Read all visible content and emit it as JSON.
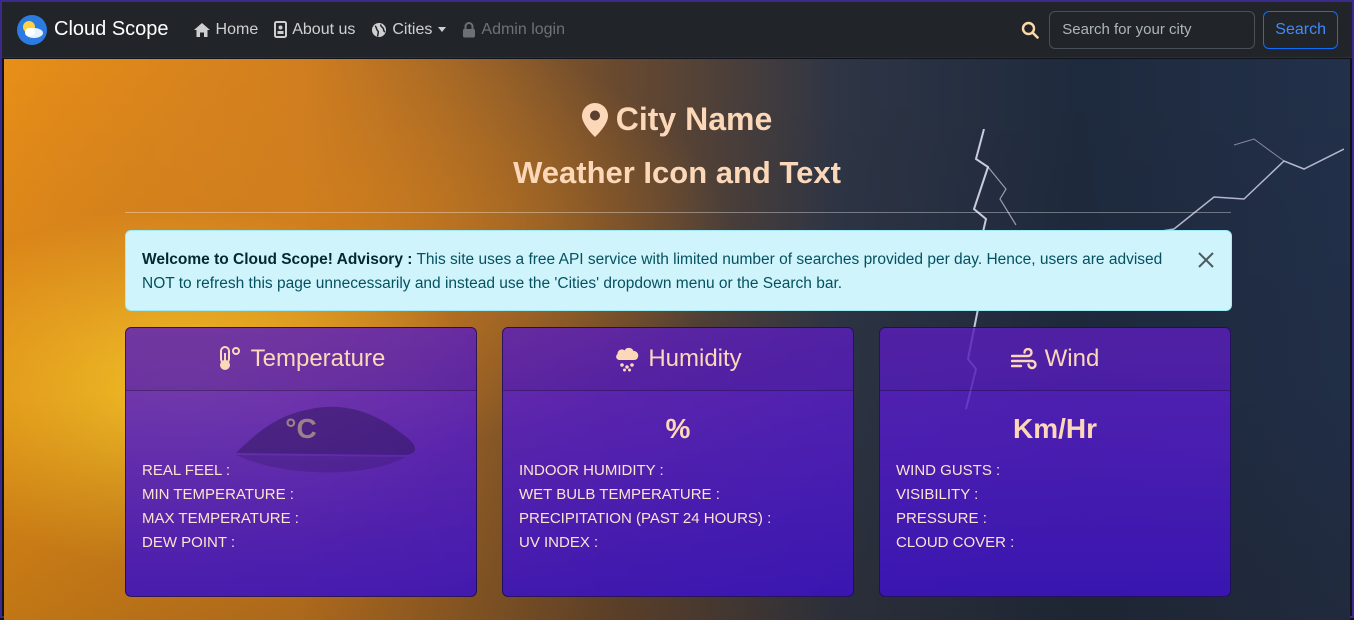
{
  "brand": {
    "name": "Cloud Scope",
    "logo": "sun-cloud-logo"
  },
  "nav": {
    "home": "Home",
    "about": "About us",
    "cities": "Cities",
    "admin": "Admin login"
  },
  "search": {
    "placeholder": "Search for your city",
    "button": "Search"
  },
  "hero": {
    "city_name": "City Name",
    "weather_text": "Weather Icon and Text"
  },
  "alert": {
    "title": "Welcome to Cloud Scope! Advisory :",
    "message": " This site uses a free API service with limited number of searches provided per day. Hence, users are advised NOT to refresh this page unnecessarily and instead use the 'Cities' dropdown menu or the Search bar."
  },
  "cards": [
    {
      "title": "Temperature",
      "icon": "thermometer-icon",
      "value": "°C",
      "items": [
        "REAL FEEL :",
        "MIN TEMPERATURE :",
        "MAX TEMPERATURE :",
        "DEW POINT :"
      ]
    },
    {
      "title": "Humidity",
      "icon": "cloud-rain-icon",
      "value": "%",
      "items": [
        "INDOOR HUMIDITY :",
        "WET BULB TEMPERATURE :",
        "PRECIPITATION (PAST 24 HOURS) :",
        "UV INDEX :"
      ]
    },
    {
      "title": "Wind",
      "icon": "wind-icon",
      "value": "Km/Hr",
      "items": [
        "WIND GUSTS :",
        "VISIBILITY :",
        "PRESSURE :",
        "CLOUD COVER :"
      ]
    }
  ],
  "colors": {
    "accent_text": "#fcd8b9",
    "card_bg": "#4a1fc4",
    "alert_bg": "#cff4fc",
    "navbar_bg": "#212529"
  }
}
